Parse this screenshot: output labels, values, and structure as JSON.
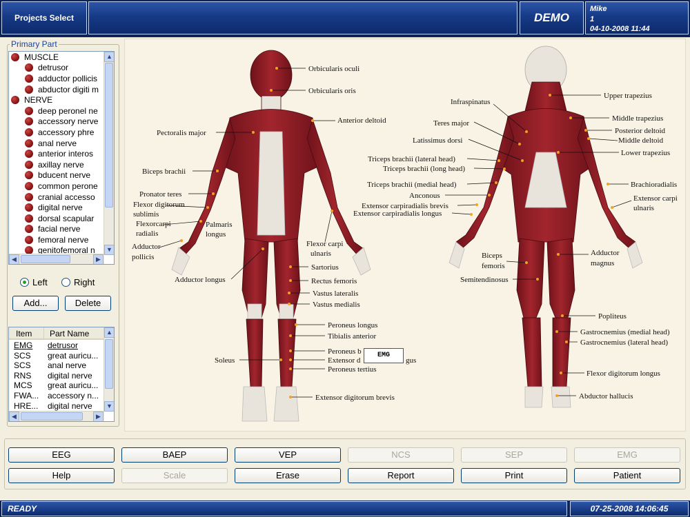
{
  "header": {
    "projects_label": "Projects Select",
    "demo_label": "DEMO",
    "user_name": "Mike",
    "user_id": "1",
    "datetime": "04-10-2008 11:44"
  },
  "left_panel": {
    "legend": "Primary Part",
    "tree": [
      {
        "label": "MUSCLE",
        "level": 0
      },
      {
        "label": "detrusor",
        "level": 1
      },
      {
        "label": "adductor pollicis",
        "level": 1
      },
      {
        "label": "abductor digiti m",
        "level": 1
      },
      {
        "label": "NERVE",
        "level": 0
      },
      {
        "label": "deep peronel ne",
        "level": 1
      },
      {
        "label": "accessory nerve",
        "level": 1
      },
      {
        "label": "accessory phre",
        "level": 1
      },
      {
        "label": "anal nerve",
        "level": 1
      },
      {
        "label": "anterior interos",
        "level": 1
      },
      {
        "label": "axillay nerve",
        "level": 1
      },
      {
        "label": "bducent nerve",
        "level": 1
      },
      {
        "label": "common perone",
        "level": 1
      },
      {
        "label": "cranial accesso",
        "level": 1
      },
      {
        "label": "digital nerve",
        "level": 1
      },
      {
        "label": "dorsal scapular",
        "level": 1
      },
      {
        "label": "facial nerve",
        "level": 1
      },
      {
        "label": "femoral nerve",
        "level": 1
      },
      {
        "label": "genitofemoral n",
        "level": 1
      }
    ],
    "side_left": "Left",
    "side_right": "Right",
    "side_selected": "Left",
    "add_label": "Add...",
    "delete_label": "Delete",
    "list_headers": [
      "Item",
      "Part Name"
    ],
    "list_rows": [
      {
        "item": "EMG",
        "part": "detrusor"
      },
      {
        "item": "SCS",
        "part": "great auricu..."
      },
      {
        "item": "SCS",
        "part": "anal nerve"
      },
      {
        "item": "RNS",
        "part": "digital nerve"
      },
      {
        "item": "MCS",
        "part": "great auricu..."
      },
      {
        "item": "FWA...",
        "part": "accessory n..."
      },
      {
        "item": "HRE...",
        "part": "digital nerve"
      }
    ]
  },
  "anatomy": {
    "front_labels": [
      "Orbicularis oculi",
      "Orbicularis oris",
      "Anterior deltoid",
      "Pectoralis major",
      "Biceps brachii",
      "Pronator teres",
      "Flexor digitorum",
      "sublimis",
      "Flexorcarpi",
      "radialis",
      "Palmaris",
      "longus",
      "Adductor",
      "pollicis",
      "Adductor longus",
      "Flexor carpi",
      "ulnaris",
      "Sartorius",
      "Rectus femoris",
      "Vastus lateralis",
      "Vastus medialis",
      "Peroneus longus",
      "Tibialis anterior",
      "Peroneus b",
      "Extensor d",
      "gus",
      "Peroneus tertius",
      "Soleus",
      "Extensor digitorum brevis"
    ],
    "back_labels": [
      "Upper trapezius",
      "Infraspinatus",
      "Middle trapezius",
      "Teres major",
      "Posterior deltoid",
      "Middle deltoid",
      "Latissimus dorsi",
      "Lower trapezius",
      "Triceps brachii (lateral head)",
      "Triceps brachii (long head)",
      "Triceps brachii (medial head)",
      "Brachioradialis",
      "Anconous",
      "Extensor carpi",
      "ulnaris",
      "Extensor carpiradialis brevis",
      "Extensor carpiradialis longus",
      "Biceps",
      "femoris",
      "Adductor",
      "magnus",
      "Semitendinosus",
      "Popliteus",
      "Gastrocnemius (medial head)",
      "Gastrocnemius (lateral head)",
      "Flexor digitorum longus",
      "Abductor hallucis"
    ],
    "tooltip": "EMG"
  },
  "buttons_row1": [
    {
      "label": "EEG",
      "enabled": true
    },
    {
      "label": "BAEP",
      "enabled": true
    },
    {
      "label": "VEP",
      "enabled": true
    },
    {
      "label": "NCS",
      "enabled": false
    },
    {
      "label": "SEP",
      "enabled": false
    },
    {
      "label": "EMG",
      "enabled": false
    }
  ],
  "buttons_row2": [
    {
      "label": "Help",
      "enabled": true
    },
    {
      "label": "Scale",
      "enabled": false
    },
    {
      "label": "Erase",
      "enabled": true
    },
    {
      "label": "Report",
      "enabled": true
    },
    {
      "label": "Print",
      "enabled": true
    },
    {
      "label": "Patient",
      "enabled": true
    }
  ],
  "status": {
    "state": "READY",
    "datetime": "07-25-2008 14:06:45"
  },
  "colors": {
    "header_blue": "#163a86",
    "muscle_red": "#8e1c24",
    "tendon_white": "#e8e4dc",
    "panel_bg": "#f3efe0"
  }
}
